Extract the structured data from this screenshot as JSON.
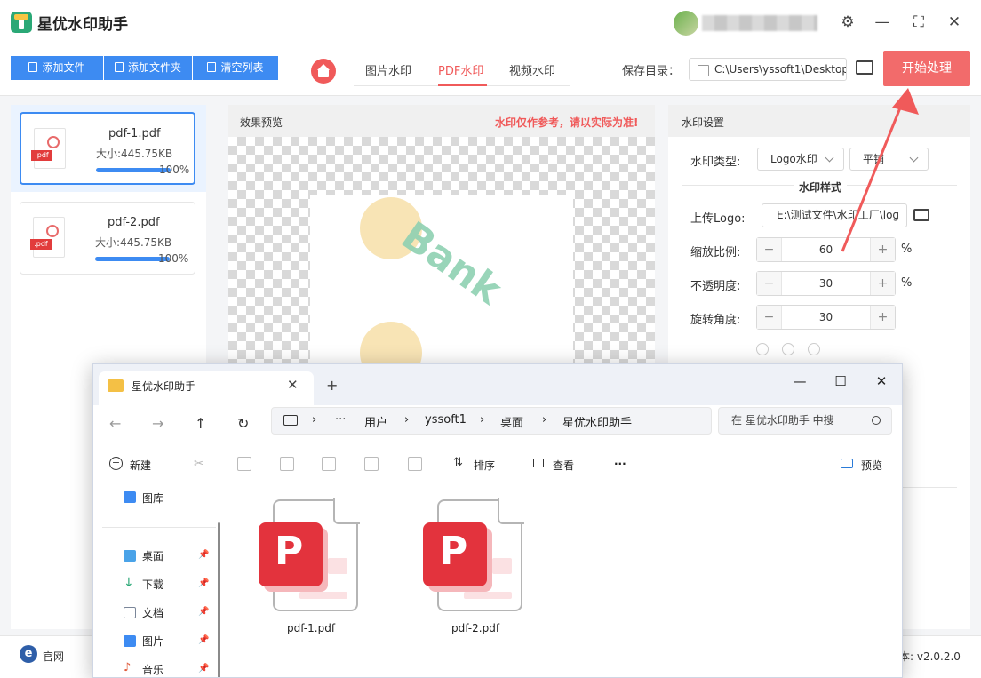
{
  "app": {
    "title": "星优水印助手",
    "window_controls": {
      "settings": "⚙",
      "minimize": "—",
      "maximize": "⛶",
      "close": "✕"
    }
  },
  "toolbar": {
    "add_file": "添加文件",
    "add_folder": "添加文件夹",
    "clear_list": "清空列表",
    "tabs": [
      "图片水印",
      "PDF水印",
      "视频水印"
    ],
    "active_tab": "PDF水印",
    "save_dir_label": "保存目录：",
    "save_dir_value": "C:\\Users\\yssoft1\\Desktop",
    "start": "开始处理"
  },
  "files": [
    {
      "name": "pdf-1.pdf",
      "size": "大小:445.75KB",
      "progress": "100%",
      "progress_value": 1.0
    },
    {
      "name": "pdf-2.pdf",
      "size": "大小:445.75KB",
      "progress": "100%",
      "progress_value": 1.0
    }
  ],
  "preview": {
    "title": "效果预览",
    "note": "水印仅作参考，请以实际为准!",
    "watermark_text": "Bank"
  },
  "settings": {
    "title": "水印设置",
    "type_label": "水印类型:",
    "type_value": "Logo水印",
    "layout_value": "平铺",
    "style_title": "水印样式",
    "upload_label": "上传Logo:",
    "upload_value": "E:\\测试文件\\水印工厂\\log",
    "scale_label": "缩放比例:",
    "scale_value": "60",
    "opacity_label": "不透明度:",
    "opacity_value": "30",
    "rotate_label": "旋转角度:",
    "rotate_value": "30",
    "percent": "%",
    "minus": "−",
    "plus": "+"
  },
  "status": {
    "site": "官网",
    "version": "本: v2.0.2.0"
  },
  "explorer": {
    "tab_title": "星优水印助手",
    "tab_close": "✕",
    "new_tab": "+",
    "win_minimize": "—",
    "win_maximize": "☐",
    "win_close": "✕",
    "nav": {
      "back": "←",
      "forward": "→",
      "up": "↑",
      "refresh": "↻"
    },
    "breadcrumb": [
      "用户",
      "yssoft1",
      "桌面",
      "星优水印助手"
    ],
    "crumb_more": "···",
    "search_placeholder": "在 星优水印助手 中搜",
    "commands": {
      "new": "新建",
      "sort": "排序",
      "view": "查看",
      "more": "···",
      "preview": "预览"
    },
    "sidebar": [
      "图库",
      "桌面",
      "下载",
      "文档",
      "图片",
      "音乐"
    ],
    "files": [
      "pdf-1.pdf",
      "pdf-2.pdf"
    ]
  },
  "colors": {
    "accent_blue": "#3d8bf2",
    "accent_red": "#f05a5a",
    "pdf_red": "#e3333d"
  }
}
